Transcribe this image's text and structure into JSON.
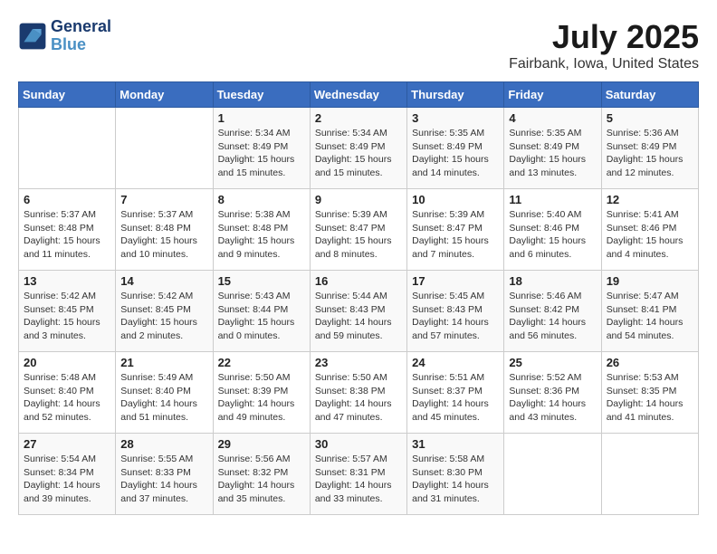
{
  "header": {
    "logo_line1": "General",
    "logo_line2": "Blue",
    "main_title": "July 2025",
    "subtitle": "Fairbank, Iowa, United States"
  },
  "weekdays": [
    "Sunday",
    "Monday",
    "Tuesday",
    "Wednesday",
    "Thursday",
    "Friday",
    "Saturday"
  ],
  "weeks": [
    [
      {
        "day": "",
        "info": ""
      },
      {
        "day": "",
        "info": ""
      },
      {
        "day": "1",
        "info": "Sunrise: 5:34 AM\nSunset: 8:49 PM\nDaylight: 15 hours and 15 minutes."
      },
      {
        "day": "2",
        "info": "Sunrise: 5:34 AM\nSunset: 8:49 PM\nDaylight: 15 hours and 15 minutes."
      },
      {
        "day": "3",
        "info": "Sunrise: 5:35 AM\nSunset: 8:49 PM\nDaylight: 15 hours and 14 minutes."
      },
      {
        "day": "4",
        "info": "Sunrise: 5:35 AM\nSunset: 8:49 PM\nDaylight: 15 hours and 13 minutes."
      },
      {
        "day": "5",
        "info": "Sunrise: 5:36 AM\nSunset: 8:49 PM\nDaylight: 15 hours and 12 minutes."
      }
    ],
    [
      {
        "day": "6",
        "info": "Sunrise: 5:37 AM\nSunset: 8:48 PM\nDaylight: 15 hours and 11 minutes."
      },
      {
        "day": "7",
        "info": "Sunrise: 5:37 AM\nSunset: 8:48 PM\nDaylight: 15 hours and 10 minutes."
      },
      {
        "day": "8",
        "info": "Sunrise: 5:38 AM\nSunset: 8:48 PM\nDaylight: 15 hours and 9 minutes."
      },
      {
        "day": "9",
        "info": "Sunrise: 5:39 AM\nSunset: 8:47 PM\nDaylight: 15 hours and 8 minutes."
      },
      {
        "day": "10",
        "info": "Sunrise: 5:39 AM\nSunset: 8:47 PM\nDaylight: 15 hours and 7 minutes."
      },
      {
        "day": "11",
        "info": "Sunrise: 5:40 AM\nSunset: 8:46 PM\nDaylight: 15 hours and 6 minutes."
      },
      {
        "day": "12",
        "info": "Sunrise: 5:41 AM\nSunset: 8:46 PM\nDaylight: 15 hours and 4 minutes."
      }
    ],
    [
      {
        "day": "13",
        "info": "Sunrise: 5:42 AM\nSunset: 8:45 PM\nDaylight: 15 hours and 3 minutes."
      },
      {
        "day": "14",
        "info": "Sunrise: 5:42 AM\nSunset: 8:45 PM\nDaylight: 15 hours and 2 minutes."
      },
      {
        "day": "15",
        "info": "Sunrise: 5:43 AM\nSunset: 8:44 PM\nDaylight: 15 hours and 0 minutes."
      },
      {
        "day": "16",
        "info": "Sunrise: 5:44 AM\nSunset: 8:43 PM\nDaylight: 14 hours and 59 minutes."
      },
      {
        "day": "17",
        "info": "Sunrise: 5:45 AM\nSunset: 8:43 PM\nDaylight: 14 hours and 57 minutes."
      },
      {
        "day": "18",
        "info": "Sunrise: 5:46 AM\nSunset: 8:42 PM\nDaylight: 14 hours and 56 minutes."
      },
      {
        "day": "19",
        "info": "Sunrise: 5:47 AM\nSunset: 8:41 PM\nDaylight: 14 hours and 54 minutes."
      }
    ],
    [
      {
        "day": "20",
        "info": "Sunrise: 5:48 AM\nSunset: 8:40 PM\nDaylight: 14 hours and 52 minutes."
      },
      {
        "day": "21",
        "info": "Sunrise: 5:49 AM\nSunset: 8:40 PM\nDaylight: 14 hours and 51 minutes."
      },
      {
        "day": "22",
        "info": "Sunrise: 5:50 AM\nSunset: 8:39 PM\nDaylight: 14 hours and 49 minutes."
      },
      {
        "day": "23",
        "info": "Sunrise: 5:50 AM\nSunset: 8:38 PM\nDaylight: 14 hours and 47 minutes."
      },
      {
        "day": "24",
        "info": "Sunrise: 5:51 AM\nSunset: 8:37 PM\nDaylight: 14 hours and 45 minutes."
      },
      {
        "day": "25",
        "info": "Sunrise: 5:52 AM\nSunset: 8:36 PM\nDaylight: 14 hours and 43 minutes."
      },
      {
        "day": "26",
        "info": "Sunrise: 5:53 AM\nSunset: 8:35 PM\nDaylight: 14 hours and 41 minutes."
      }
    ],
    [
      {
        "day": "27",
        "info": "Sunrise: 5:54 AM\nSunset: 8:34 PM\nDaylight: 14 hours and 39 minutes."
      },
      {
        "day": "28",
        "info": "Sunrise: 5:55 AM\nSunset: 8:33 PM\nDaylight: 14 hours and 37 minutes."
      },
      {
        "day": "29",
        "info": "Sunrise: 5:56 AM\nSunset: 8:32 PM\nDaylight: 14 hours and 35 minutes."
      },
      {
        "day": "30",
        "info": "Sunrise: 5:57 AM\nSunset: 8:31 PM\nDaylight: 14 hours and 33 minutes."
      },
      {
        "day": "31",
        "info": "Sunrise: 5:58 AM\nSunset: 8:30 PM\nDaylight: 14 hours and 31 minutes."
      },
      {
        "day": "",
        "info": ""
      },
      {
        "day": "",
        "info": ""
      }
    ]
  ]
}
